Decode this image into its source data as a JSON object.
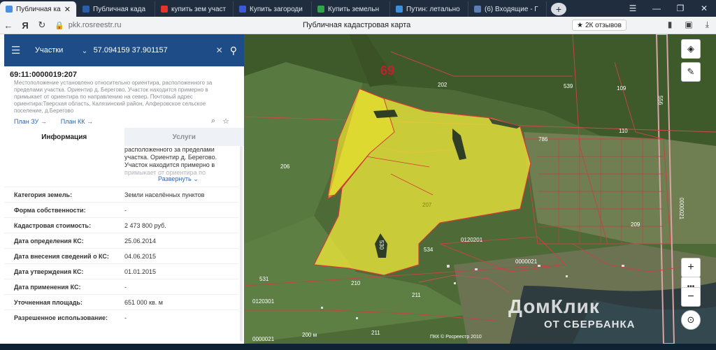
{
  "tabs": [
    {
      "label": "Публичная ка",
      "color": "#4a8fe0",
      "active": true
    },
    {
      "label": "Публичная када",
      "color": "#2a5ea8"
    },
    {
      "label": "купить зем участ",
      "color": "#e3332b"
    },
    {
      "label": "Купить загороди",
      "color": "#3b5bd6"
    },
    {
      "label": "Купить земельн",
      "color": "#33a24a"
    },
    {
      "label": "Путин: летально",
      "color": "#3f8fd8"
    },
    {
      "label": "(6) Входящие - Г",
      "color": "#5d7db4"
    }
  ],
  "address": {
    "url": "pkk.rosreestr.ru",
    "page_title": "Публичная кадастровая карта",
    "reviews": "2К отзывов"
  },
  "search": {
    "type": "Участки",
    "query": "57.094159 37.901157"
  },
  "object": {
    "number": "69:11:0000019:207",
    "description": "Местоположение установлено относительно ориентира, расположенного за пределами участка. Ориентир д. Берегово. Участок находится примерно в примыкает от ориентира по направлению на север. Почтовый адрес ориентира:Тверская область, Калязинский район, Алферовское сельское поселение, д.Берегово",
    "plan_zu": "План ЗУ",
    "plan_kk": "План КК"
  },
  "detail_tabs": {
    "info": "Информация",
    "services": "Услуги"
  },
  "address_excerpt": {
    "visible": "расположенного за пределами участка. Ориентир д. Берегово. Участок находится примерно в",
    "faded": "примыкает от ориентира по",
    "expand": "Развернуть"
  },
  "attributes": [
    {
      "key": "Категория земель:",
      "value": "Земли населённых пунктов"
    },
    {
      "key": "Форма собственности:",
      "value": "-"
    },
    {
      "key": "Кадастровая стоимость:",
      "value": "2 473 800 руб."
    },
    {
      "key": "Дата определения КС:",
      "value": "25.06.2014"
    },
    {
      "key": "Дата внесения сведений о КС:",
      "value": "04.06.2015"
    },
    {
      "key": "Дата утверждения КС:",
      "value": "01.01.2015"
    },
    {
      "key": "Дата применения КС:",
      "value": "-"
    },
    {
      "key": "Уточненная площадь:",
      "value": "651 000 кв. м"
    },
    {
      "key": "Разрешенное использование:",
      "value": "-"
    }
  ],
  "map": {
    "district_label": "69",
    "scale_label": "200 м",
    "copyright": "ПКК © Росреестр 2010",
    "watermark": "ДомКлик",
    "watermark_sub": "ОТ СБЕРБАНКА",
    "parcel_labels": [
      "207",
      "202",
      "539",
      "109",
      "556",
      "110",
      "786",
      "206",
      "209",
      "530",
      "534",
      "210",
      "211",
      "531",
      "0120201",
      "0120301",
      "0000021",
      "211",
      "0000021",
      "0000021"
    ],
    "highlight_color": "#e8e33a"
  }
}
